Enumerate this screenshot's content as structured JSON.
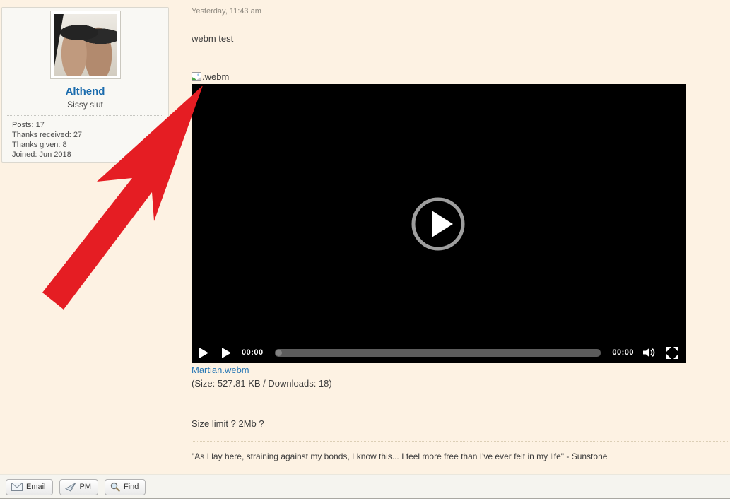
{
  "sidebar": {
    "username": "Althend",
    "user_title": "Sissy slut",
    "stats": [
      "Posts: 17",
      "Thanks received: 27",
      "Thanks given: 8",
      "Joined: Jun 2018"
    ]
  },
  "post": {
    "timestamp": "Yesterday, 11:43 am",
    "body_text": "webm test",
    "attachment_inline_label": ".webm",
    "video_player": {
      "current_time": "00:00",
      "duration": "00:00"
    },
    "attachment": {
      "filename": "Martian.webm",
      "meta": "(Size: 527.81 KB / Downloads: 18)"
    },
    "question_text": "Size limit ? 2Mb ?",
    "signature": "\"As I lay here, straining against my bonds, I know this... I feel more free than I've ever felt in my life\" - Sunstone"
  },
  "footer": {
    "email_label": "Email",
    "pm_label": "PM",
    "find_label": "Find"
  },
  "colors": {
    "page_bg": "#fdf2e3",
    "panel_bg": "#f9f8f4",
    "annotation_red": "#e51d23",
    "username_blue": "#1a6bad",
    "link_blue": "#2878b5",
    "video_bg": "#000000"
  }
}
